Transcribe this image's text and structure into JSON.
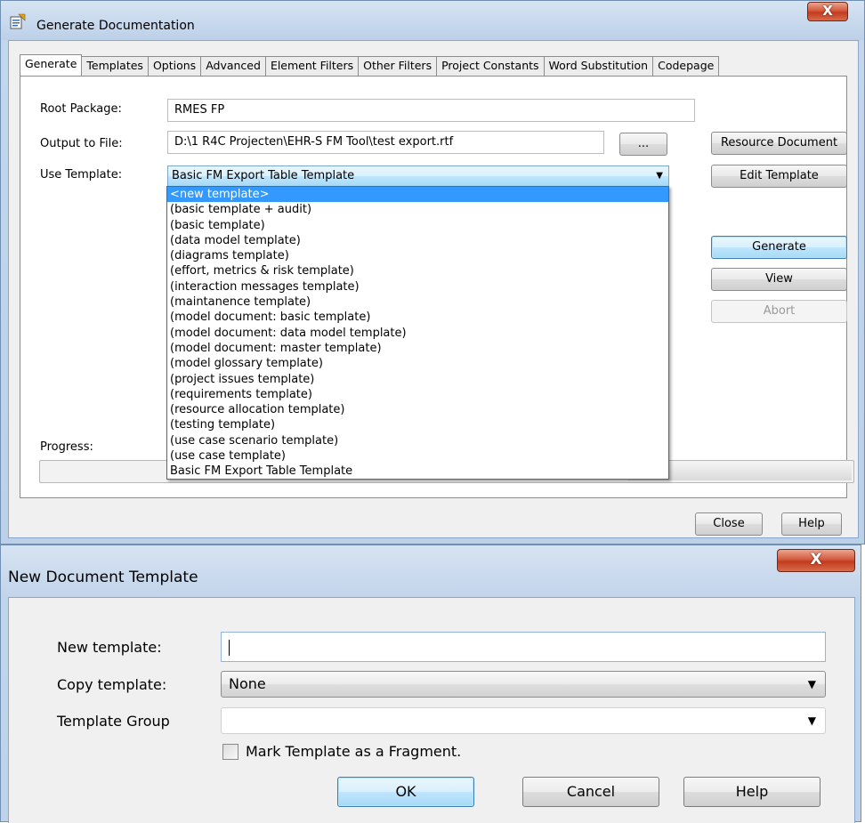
{
  "gen": {
    "title": "Generate Documentation",
    "tabs": [
      "Generate",
      "Templates",
      "Options",
      "Advanced",
      "Element Filters",
      "Other Filters",
      "Project Constants",
      "Word Substitution",
      "Codepage"
    ],
    "root_label": "Root Package:",
    "root_value": "RMES FP",
    "output_label": "Output to File:",
    "output_value": "D:\\1 R4C Projecten\\EHR-S FM Tool\\test export.rtf",
    "browse_label": "...",
    "resource_label": "Resource Document",
    "template_label": "Use Template:",
    "template_value": "Basic FM Export Table Template",
    "edit_label": "Edit Template",
    "generate_label": "Generate",
    "view_label": "View",
    "abort_label": "Abort",
    "progress_label": "Progress:",
    "close_label": "Close",
    "help_label": "Help",
    "template_options": [
      "<new template>",
      "(basic template + audit)",
      "(basic template)",
      "(data model template)",
      "(diagrams template)",
      "(effort, metrics & risk template)",
      "(interaction messages template)",
      "(maintanence template)",
      "(model document: basic template)",
      "(model document: data model template)",
      "(model document: master template)",
      "(model glossary template)",
      "(project issues template)",
      "(requirements template)",
      "(resource allocation template)",
      "(testing template)",
      "(use case scenario template)",
      "(use case template)",
      "Basic FM Export Table Template"
    ],
    "close_glyph": "X"
  },
  "newtpl": {
    "title": "New Document Template",
    "new_label": "New template:",
    "new_value": "",
    "copy_label": "Copy template:",
    "copy_value": "None",
    "group_label": "Template Group",
    "group_value": "",
    "fragment_label": "Mark Template as a Fragment.",
    "ok_label": "OK",
    "cancel_label": "Cancel",
    "help_label": "Help",
    "close_glyph": "X"
  }
}
